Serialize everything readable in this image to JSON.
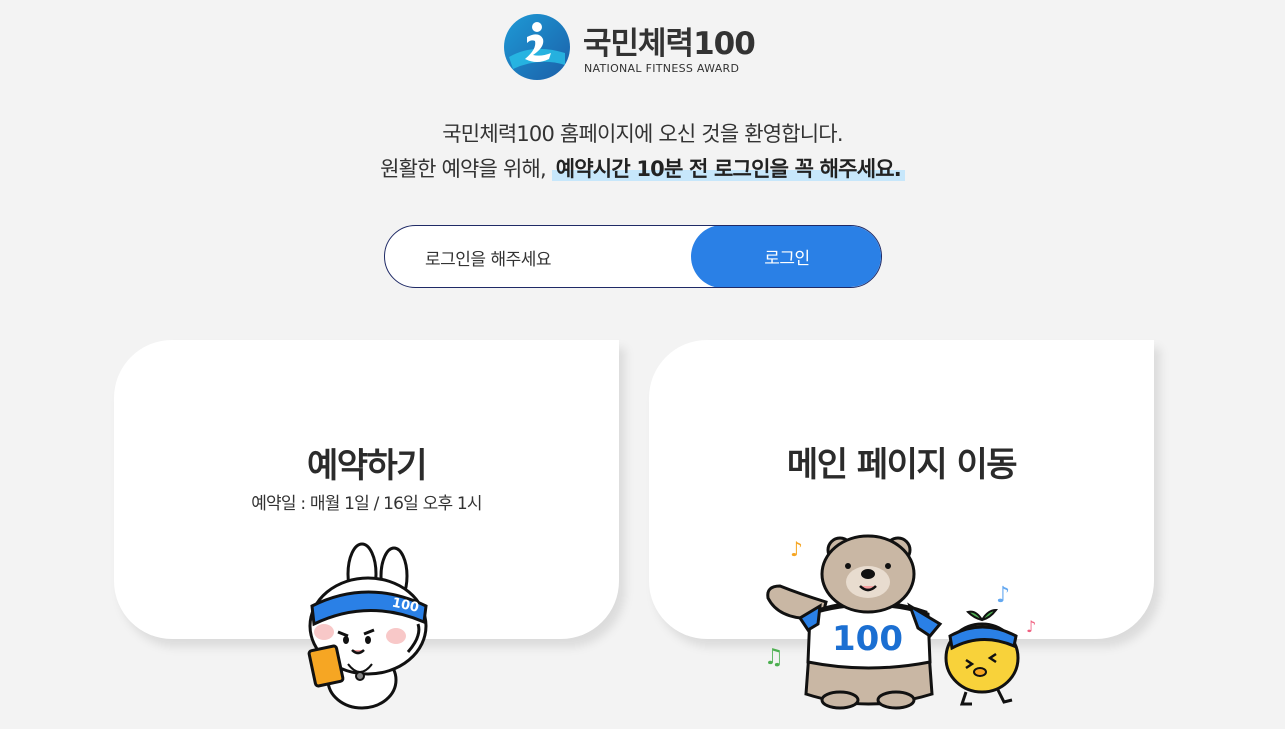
{
  "logo": {
    "title": "국민체력100",
    "subtitle": "NATIONAL FITNESS AWARD"
  },
  "welcome": {
    "line1": "국민체력100 홈페이지에 오신 것을 환영합니다.",
    "line2_prefix": "원활한 예약을 위해,",
    "line2_highlight": "예약시간 10분 전 로그인을 꼭 해주세요."
  },
  "login": {
    "prompt": "로그인을 해주세요",
    "button_label": "로그인"
  },
  "cards": {
    "reserve": {
      "title": "예약하기",
      "subtitle": "예약일 : 매월 1일 / 16일 오후 1시",
      "badge_number": "100"
    },
    "main": {
      "title": "메인 페이지 이동",
      "badge_number": "100"
    }
  },
  "colors": {
    "background": "#f3f3f3",
    "accent_blue": "#2a80e6",
    "highlight": "#c7e7fb",
    "border_navy": "#1f2a66"
  }
}
